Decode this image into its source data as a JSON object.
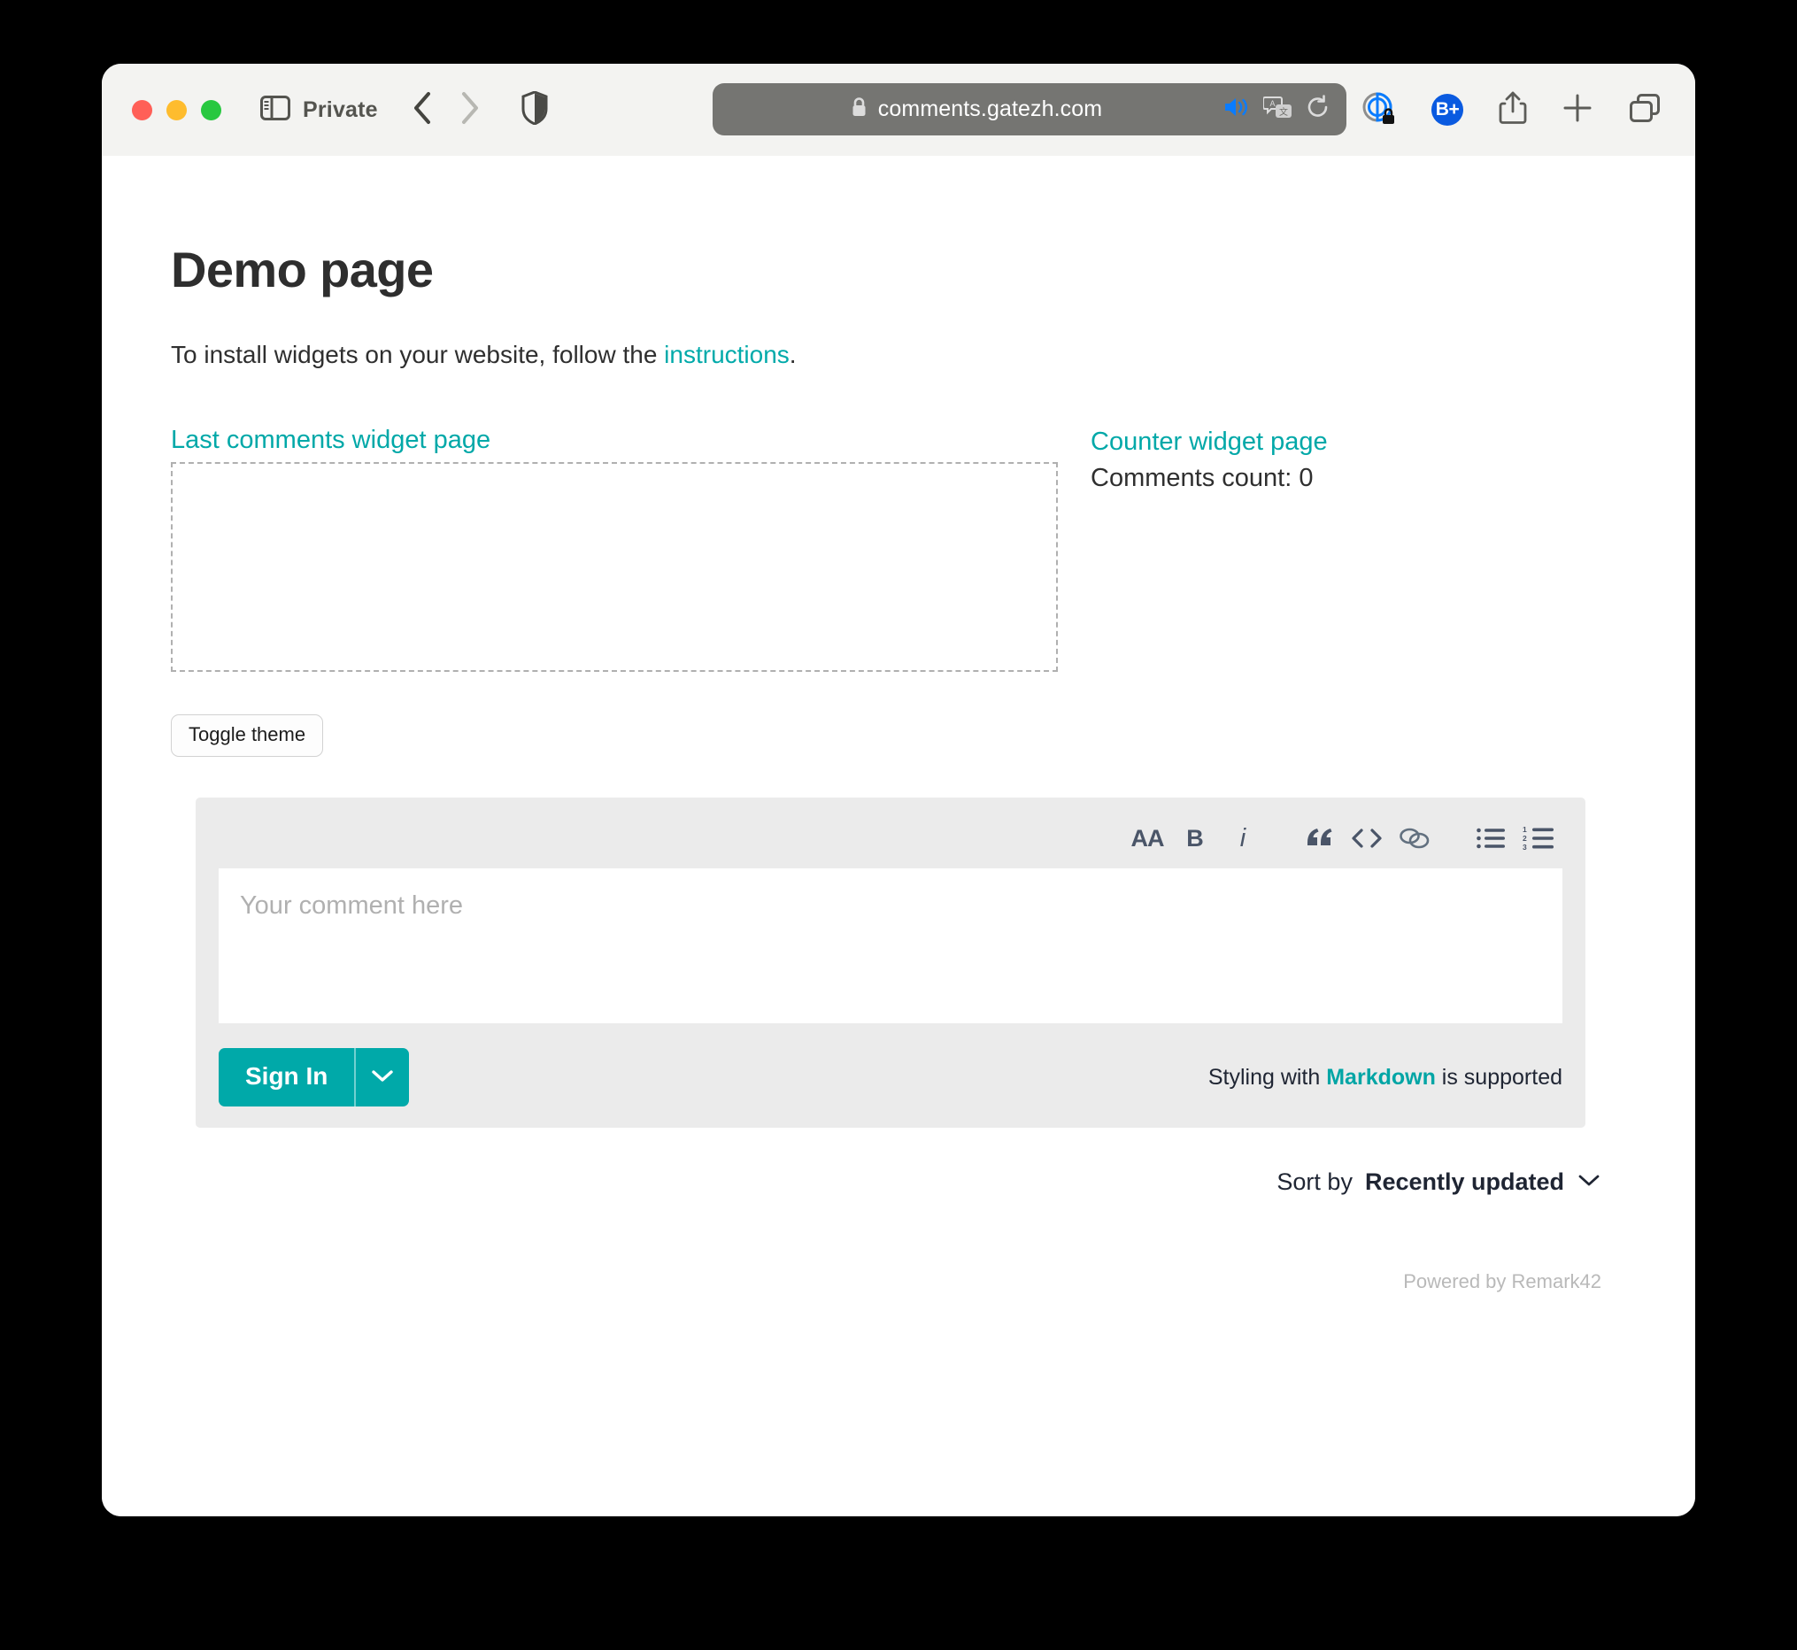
{
  "browser": {
    "traffic_lights": [
      "close",
      "minimize",
      "zoom"
    ],
    "sidebar_toggle_icon": "sidebar-icon",
    "private_label": "Private",
    "back_icon": "chevron-left-icon",
    "forward_icon": "chevron-right-icon",
    "shield_icon": "privacy-shield-icon",
    "url": {
      "lock_icon": "lock-icon",
      "text": "comments.gatezh.com",
      "audio_icon": "speaker-icon",
      "translate_icon": "translate-icon",
      "reload_icon": "reload-icon",
      "audio_color": "#0a7cff"
    },
    "right_icons": [
      {
        "name": "privacy-report-icon",
        "label": ""
      },
      {
        "name": "bitwarden-badge-icon",
        "label": "B+"
      },
      {
        "name": "share-icon",
        "label": ""
      },
      {
        "name": "new-tab-icon",
        "label": ""
      },
      {
        "name": "tab-overview-icon",
        "label": ""
      }
    ]
  },
  "page": {
    "title": "Demo page",
    "intro_before": "To install widgets on your website, follow the ",
    "intro_link": "instructions",
    "intro_after": ".",
    "last_comments_link": "Last comments widget page",
    "counter_link": "Counter widget page",
    "comments_count": "Comments count: 0",
    "toggle_theme": "Toggle theme"
  },
  "editor": {
    "toolbar": [
      {
        "name": "font-size-icon",
        "label": "AA"
      },
      {
        "name": "bold-icon",
        "label": "B"
      },
      {
        "name": "italic-icon",
        "label": "i"
      },
      {
        "name": "blockquote-icon",
        "label": "“"
      },
      {
        "name": "code-icon",
        "label": "<>"
      },
      {
        "name": "link-icon",
        "label": ""
      },
      {
        "name": "bullet-list-icon",
        "label": ""
      },
      {
        "name": "numbered-list-icon",
        "label": ""
      }
    ],
    "placeholder": "Your comment here",
    "signin_label": "Sign In",
    "signin_caret_icon": "chevron-down-icon",
    "markdown_before": "Styling with ",
    "markdown_word": "Markdown",
    "markdown_after": " is supported"
  },
  "sort": {
    "label": "Sort by",
    "value": "Recently updated",
    "caret_icon": "chevron-down-icon"
  },
  "footer": {
    "powered_by": "Powered by Remark42"
  },
  "colors": {
    "accent": "#00a8a8",
    "url_bar": "#757572",
    "toolbar_bg": "#f3f3f1",
    "editor_bg": "#ebebeb"
  }
}
